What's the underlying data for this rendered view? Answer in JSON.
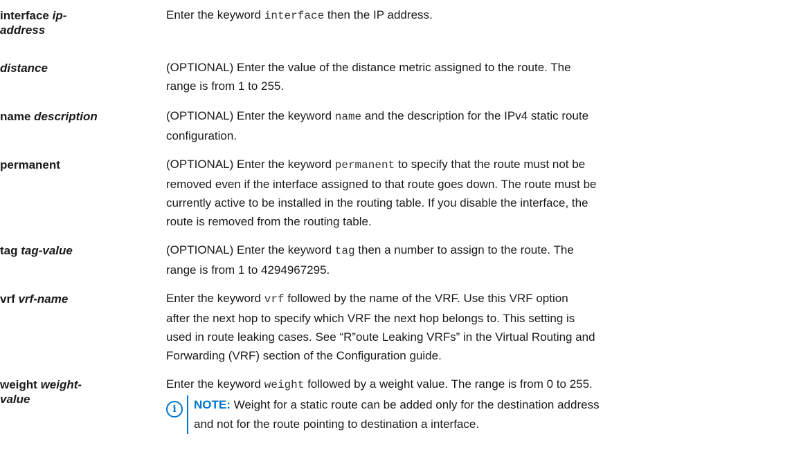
{
  "params": [
    {
      "kw": "interface",
      "arg1": "ip-",
      "arg2": "address",
      "desc": [
        {
          "t": "Enter the keyword "
        },
        {
          "c": "interface"
        },
        {
          "t": " then the IP address."
        }
      ]
    },
    {
      "kw": "",
      "arg1": "distance",
      "arg2": "",
      "desc_lines": [
        "(OPTIONAL) Enter the value of the distance metric assigned to the route. The",
        "range is from 1 to 255."
      ]
    },
    {
      "kw": "name",
      "arg1": "description",
      "desc_l1_a": "(OPTIONAL) Enter the keyword ",
      "desc_l1_code": "name",
      "desc_l1_b": " and the description for the IPv4 static route",
      "desc_l2": "configuration."
    },
    {
      "kw": "permanent",
      "desc_l1_a": "(OPTIONAL) Enter the keyword ",
      "desc_l1_code": "permanent",
      "desc_l1_b": " to specify that the route must not be",
      "desc_l2": "removed even if the interface assigned to that route goes down. The route must be",
      "desc_l3": "currently active to be installed in the routing table. If you disable the interface, the",
      "desc_l4": "route is removed from the routing table."
    },
    {
      "kw": "tag",
      "arg1": "tag-value",
      "desc_l1_a": "(OPTIONAL) Enter the keyword ",
      "desc_l1_code": "tag",
      "desc_l1_b": " then a number to assign to the route. The",
      "desc_l2": "range is from 1 to 4294967295."
    },
    {
      "kw": "vrf",
      "arg1": "vrf-name",
      "desc_l1_a": "Enter the keyword ",
      "desc_l1_code": "vrf",
      "desc_l1_b": " followed by the name of the VRF. Use this VRF option",
      "desc_l2": "after the next hop to specify which VRF the next hop belongs to. This setting is",
      "desc_l3": "used in route leaking cases. See “R”oute Leaking VRFs” in the Virtual Routing and",
      "desc_l4": "Forwarding (VRF) section of the Configuration guide."
    },
    {
      "kw": "weight",
      "arg1": "weight-",
      "arg2": "value",
      "desc_l1_a": "Enter the keyword ",
      "desc_l1_code": "weight",
      "desc_l1_b": " followed by a weight value. The range is from 0 to 255."
    }
  ],
  "interface_desc_a": "Enter the keyword ",
  "interface_desc_code": "interface",
  "interface_desc_b": " then the IP address.",
  "note": {
    "icon": "info-icon",
    "label": "NOTE:",
    "text_l1": " Weight for a static route can be added only for the destination address",
    "text_l2": "and not for the route pointing to destination a interface."
  },
  "colors": {
    "accent": "#0076ce",
    "text": "#1a1a1a"
  }
}
